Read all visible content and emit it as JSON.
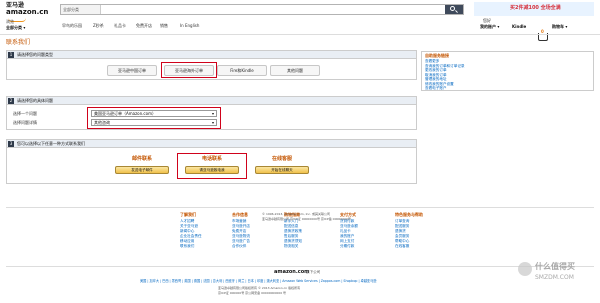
{
  "header": {
    "logo_cn": "亚马逊",
    "logo_en": "amazon.cn",
    "search_category": "全部分类",
    "search_placeholder": "",
    "promo_text": "买2件减100 全场全满",
    "category_button": "全部分类 ▾",
    "category_sub": "浏览",
    "nav": [
      "早鸟的乐园",
      "Z秒杀",
      "礼品卡",
      "免费开店",
      "销售",
      "In English"
    ],
    "greeting": "您好",
    "account_label": "我的账户 ▾",
    "kindle": "Kindle",
    "cart_count": "0",
    "cart_label": "购物车 ▾"
  },
  "page_title": "联系我们",
  "section1": {
    "number": "1",
    "label": "请选择您的问题类型",
    "options": [
      "亚马逊中国订单",
      "亚马逊海外订单",
      "Fire和Kindle",
      "其他问题"
    ]
  },
  "section2": {
    "number": "2",
    "label": "请选择您的具体问题",
    "issue_label": "选择一个问题",
    "issue_value": "美国亚马逊订单（Amazon.com）",
    "detail_label": "选择问题详情",
    "detail_value": "其他咨询"
  },
  "section3": {
    "number": "3",
    "label": "您可以选择以下任意一种方式联系我们",
    "methods": [
      {
        "title": "邮件联系",
        "button": "发送电子邮件"
      },
      {
        "title": "电话联系",
        "button": "请亚马逊致电我"
      },
      {
        "title": "在线客服",
        "button": "开始在线聊天"
      }
    ]
  },
  "sidebar": {
    "title": "自助服务链接",
    "links": [
      "查看更多",
      "查询我的订单和订单记录",
      "更改我的订单",
      "取消我的订单",
      "管理我的地址",
      "修改我的账户设置",
      "查看电子账户"
    ]
  },
  "footer": {
    "columns": [
      {
        "heading": "了解我们",
        "links": [
          "人才招聘",
          "关于亚马逊",
          "新闻中心",
          "企业社会责任",
          "移动应用",
          "联系我们"
        ]
      },
      {
        "heading": "合作信息",
        "links": [
          "市场营销",
          "亚马逊开店",
          "免费开店",
          "亚马逊物流",
          "亚马逊广告",
          "合作伙伴"
        ]
      },
      {
        "heading": "购物指南",
        "links": [
          "新手入门",
          "配送信息",
          "退换货政策",
          "售后服务",
          "退换货须知",
          "物流相关"
        ]
      },
      {
        "heading": "支付方式",
        "links": [
          "货到付款",
          "亚马逊余额",
          "礼品卡",
          "我的账户",
          "网上支付",
          "分期付款"
        ]
      },
      {
        "heading": "特色服务与帮助",
        "links": [
          "订单查询",
          "配送服务",
          "退换货",
          "会员服务",
          "帮助中心",
          "在线客服"
        ]
      }
    ],
    "copyright": "© 1996-2013, Amazon.com, Inc. 或其关联公司",
    "icp": "亚马逊卓越有限公司 京ICP证 00000000号 京ICP备 00000000号",
    "amazon_logo": "amazon.com",
    "amazon_logo_sub": "旗下公司",
    "bottom_links": "美国 | 加拿大 | 巴西 | 墨西哥 | 英国 | 德国 | 法国 | 意大利 | 西班牙 | 荷兰 | 日本 | 印度 | 澳大利亚 | Amazon Web Services | Zappos.com | Shopbop | 卓越亚马逊",
    "bottom_text_1": "亚马逊卓越有限公司版权所有 © 2013 Amazon.cn 版权所有",
    "bottom_text_2": "京ICP证 000000号 京公网安备 00000000000 号"
  },
  "watermark": {
    "text_cn": "什么值得买",
    "text_en": "SMZDM.COM"
  },
  "colors": {
    "accent": "#c45500",
    "highlight": "#d0021b",
    "button": "#f0c14b",
    "link": "#0066c0",
    "section_head": "#e9eef4"
  }
}
